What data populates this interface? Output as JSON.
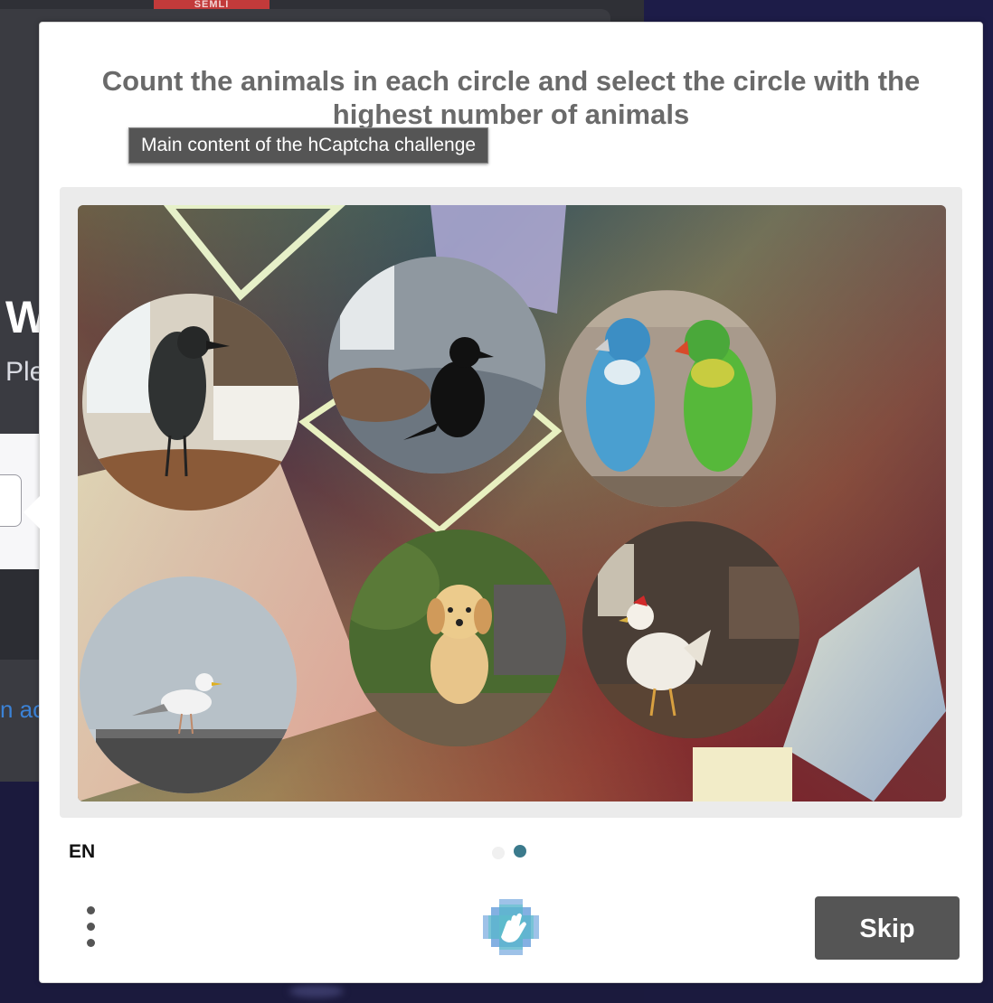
{
  "background": {
    "tab_label": "SEMLI",
    "heading": "W",
    "subtext": "Ple",
    "link": "n ac"
  },
  "challenge": {
    "prompt": "Count the animals in each circle and select the circle with the highest number of animals",
    "tooltip": "Main content of the hCaptcha challenge",
    "circles": [
      {
        "name": "crow-on-table",
        "animals": "crow",
        "count": 1
      },
      {
        "name": "crow-on-bed",
        "animals": "crow",
        "count": 1
      },
      {
        "name": "two-parrots",
        "animals": "parrots",
        "count": 2
      },
      {
        "name": "seagull-on-pier",
        "animals": "seagull",
        "count": 1
      },
      {
        "name": "puppy-on-bench",
        "animals": "puppy",
        "count": 1
      },
      {
        "name": "chicken-indoors",
        "animals": "chicken",
        "count": 1
      }
    ]
  },
  "footer": {
    "language": "EN",
    "page_indicator": {
      "total": 2,
      "current": 2
    },
    "skip_label": "Skip"
  },
  "colors": {
    "accent": "#3b7a8c",
    "button": "#555555",
    "prompt_text": "#6a6a6a"
  }
}
